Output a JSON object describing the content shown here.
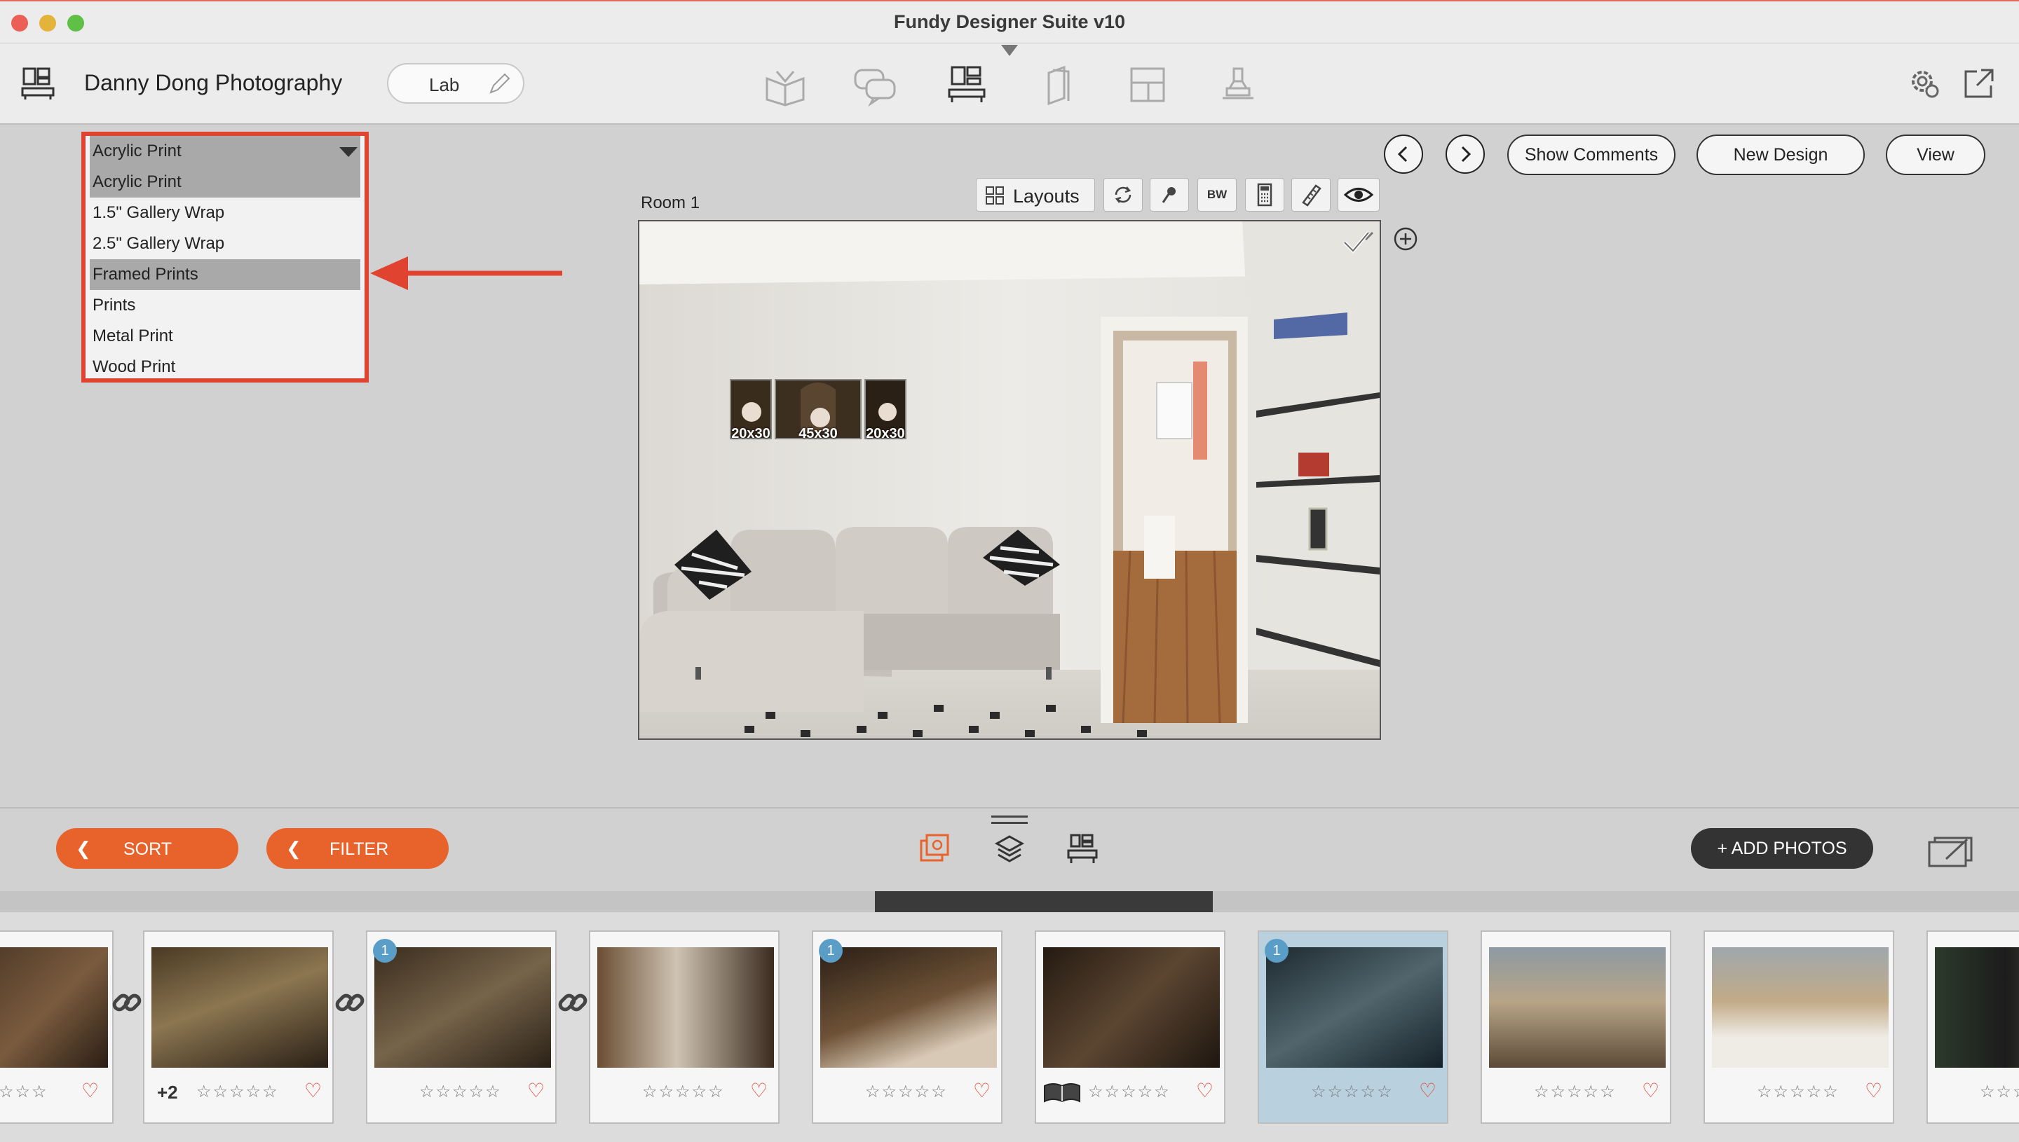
{
  "window": {
    "title": "Fundy Designer Suite v10"
  },
  "toolbar": {
    "studio_name": "Danny Dong Photography",
    "lab_label": "Lab",
    "modes": [
      "album-designer-icon",
      "proofing-icon",
      "wall-designer-icon",
      "cards-icon",
      "layouts-icon",
      "stamp-icon"
    ]
  },
  "design": {
    "room_label": "Room 1",
    "layouts_label": "Layouts",
    "bw_label": "BW",
    "buttons": {
      "show_comments": "Show Comments",
      "new_design": "New Design",
      "view": "View"
    },
    "prints": [
      {
        "size": "20x30"
      },
      {
        "size": "45x30"
      },
      {
        "size": "20x30"
      }
    ]
  },
  "product_dropdown": {
    "selected": "Acrylic Print",
    "options": [
      {
        "label": "Acrylic Print",
        "highlighted": true
      },
      {
        "label": "1.5\" Gallery Wrap",
        "highlighted": false
      },
      {
        "label": "2.5\" Gallery Wrap",
        "highlighted": false
      },
      {
        "label": "Framed Prints",
        "highlighted": true
      },
      {
        "label": "Prints",
        "highlighted": false
      },
      {
        "label": "Metal Print",
        "highlighted": false
      },
      {
        "label": "Wood Print",
        "highlighted": false
      }
    ]
  },
  "bottom": {
    "sort_label": "SORT",
    "filter_label": "FILTER",
    "add_photos_label": "+ ADD PHOTOS"
  },
  "filmstrip": [
    {
      "badge": "",
      "extra": "",
      "selected": false
    },
    {
      "badge": "",
      "extra": "+2",
      "selected": false
    },
    {
      "badge": "1",
      "extra": "",
      "selected": false
    },
    {
      "badge": "",
      "extra": "",
      "selected": false
    },
    {
      "badge": "1",
      "extra": "",
      "selected": false
    },
    {
      "badge": "",
      "extra": "",
      "selected": false
    },
    {
      "badge": "1",
      "extra": "",
      "selected": true
    },
    {
      "badge": "",
      "extra": "",
      "selected": false
    },
    {
      "badge": "",
      "extra": "",
      "selected": false
    },
    {
      "badge": "",
      "extra": "",
      "selected": false
    }
  ],
  "colors": {
    "accent": "#e8622b",
    "annotation": "#e0432f",
    "badge": "#5a9ec7",
    "selected_card": "#b9d1de"
  }
}
